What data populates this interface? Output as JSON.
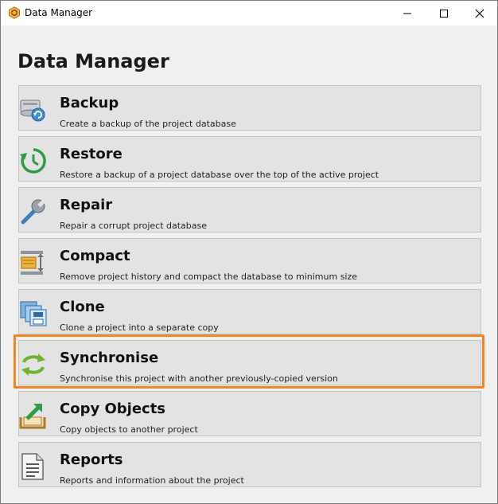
{
  "window": {
    "title": "Data Manager",
    "controls": {
      "minimize": "minimize",
      "maximize": "maximize",
      "close": "close"
    }
  },
  "page": {
    "heading": "Data Manager"
  },
  "items": [
    {
      "label": "Backup",
      "description": "Create a backup of the project database",
      "icon": "backup-icon"
    },
    {
      "label": "Restore",
      "description": "Restore a backup of a project database over the top of the active project",
      "icon": "restore-icon"
    },
    {
      "label": "Repair",
      "description": "Repair a corrupt project database",
      "icon": "wrench-icon"
    },
    {
      "label": "Compact",
      "description": "Remove project history and compact the database to minimum size",
      "icon": "compact-icon"
    },
    {
      "label": "Clone",
      "description": "Clone a project into a separate copy",
      "icon": "clone-icon"
    },
    {
      "label": "Synchronise",
      "description": "Synchronise this project with another previously-copied version",
      "icon": "sync-icon",
      "highlighted": true
    },
    {
      "label": "Copy Objects",
      "description": "Copy objects to another project",
      "icon": "copy-objects-icon"
    },
    {
      "label": "Reports",
      "description": "Reports and information about the project",
      "icon": "report-icon"
    }
  ],
  "colors": {
    "highlight": "#f5851f",
    "item_bg": "#e3e3e3",
    "window_bg": "#f0f0f0"
  }
}
